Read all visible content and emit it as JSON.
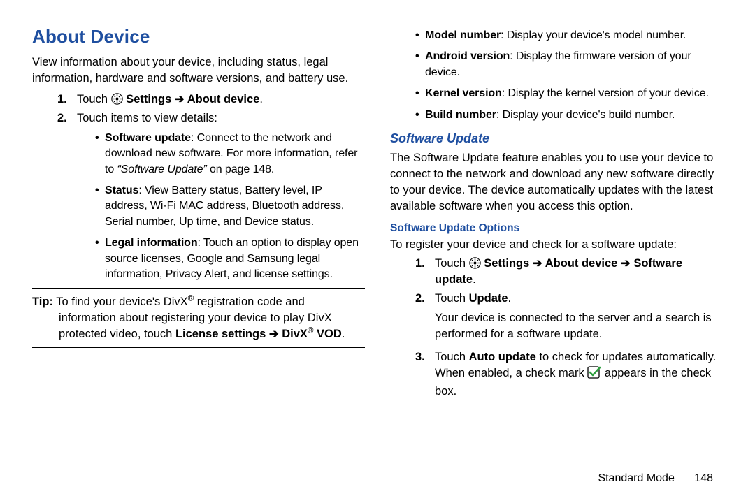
{
  "left": {
    "h1": "About Device",
    "intro": "View information about your device, including status, legal information, hardware and software versions, and battery use.",
    "step1_a": "Touch ",
    "step1_b": " Settings ",
    "step1_arrow": "➔",
    "step1_c": " About device",
    "step1_d": ".",
    "step2": "Touch items to view details:",
    "b1_title": "Software update",
    "b1_rest": ": Connect to the network and download new software. For more information, refer to ",
    "b1_ref": "“Software Update”",
    "b1_tail": " on page 148.",
    "b2_title": "Status",
    "b2_rest": ": View Battery status, Battery level, IP address, Wi-Fi MAC address, Bluetooth address, Serial number, Up time, and Device status.",
    "b3_title": "Legal information",
    "b3_rest": ": Touch an option to display open source licenses, Google and Samsung legal information, Privacy Alert, and license settings.",
    "tip_label": "Tip:",
    "tip_a": " To find your device's DivX",
    "tip_b": " registration code and information about registering your device to play DivX protected video, touch ",
    "tip_c": "License settings ",
    "tip_arrow": "➔",
    "tip_d": " DivX",
    "tip_e": " VOD",
    "tip_f": "."
  },
  "right": {
    "r1_t": "Model number",
    "r1_r": ": Display your device's model number.",
    "r2_t": "Android version",
    "r2_r": ": Display the firmware version of your device.",
    "r3_t": "Kernel version",
    "r3_r": ": Display the kernel version of your device.",
    "r4_t": "Build number",
    "r4_r": ": Display your device's build number.",
    "h2": "Software Update",
    "p1": "The Software Update feature enables you to use your device to connect to the network and download any new software directly to your device. The device automatically updates with the latest available software when you access this option.",
    "h3": "Software Update Options",
    "p2": "To register your device and check for a software update:",
    "s1_a": "Touch ",
    "s1_b": " Settings ",
    "s1_arrow1": "➔",
    "s1_c": " About device ",
    "s1_arrow2": "➔",
    "s1_d": " Software update",
    "s1_e": ".",
    "s2_a": "Touch ",
    "s2_b": "Update",
    "s2_c": ".",
    "s2_p": "Your device is connected to the server and a search is performed for a software update.",
    "s3_a": "Touch ",
    "s3_b": "Auto update",
    "s3_c": " to check for updates automatically. When enabled, a check mark ",
    "s3_d": " appears in the check box."
  },
  "footer": {
    "mode": "Standard Mode",
    "page": "148"
  }
}
